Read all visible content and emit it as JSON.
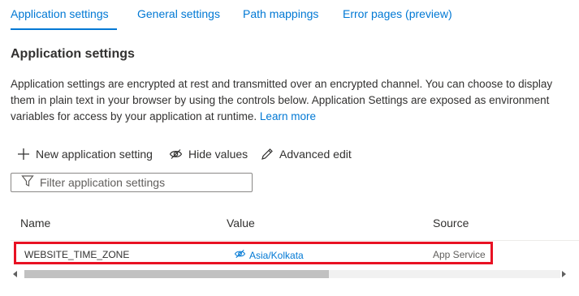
{
  "tabs": [
    {
      "label": "Application settings",
      "active": true
    },
    {
      "label": "General settings",
      "active": false
    },
    {
      "label": "Path mappings",
      "active": false
    },
    {
      "label": "Error pages (preview)",
      "active": false
    }
  ],
  "section": {
    "title": "Application settings",
    "description": "Application settings are encrypted at rest and transmitted over an encrypted channel. You can choose to display them in plain text in your browser by using the controls below. Application Settings are exposed as environment variables for access by your application at runtime.",
    "learn_more": "Learn more"
  },
  "toolbar": {
    "new_setting": "New application setting",
    "hide_values": "Hide values",
    "advanced_edit": "Advanced edit"
  },
  "filter": {
    "placeholder": "Filter application settings",
    "value": ""
  },
  "table": {
    "columns": [
      "Name",
      "Value",
      "Source"
    ],
    "rows": [
      {
        "name": "WEBSITE_TIME_ZONE",
        "value": "Asia/Kolkata",
        "source": "App Service"
      }
    ]
  },
  "colors": {
    "accent": "#0078d4",
    "highlight": "#e81123"
  },
  "icons": [
    "plus-icon",
    "eye-hide-icon",
    "pencil-icon",
    "filter-icon",
    "eye-hide-icon"
  ]
}
